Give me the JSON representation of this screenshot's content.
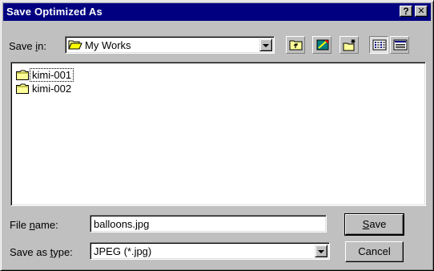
{
  "window": {
    "title": "Save Optimized As",
    "help_button": "?",
    "close_button": "✕",
    "title_bg": "#000080"
  },
  "toolbar": {
    "save_in_prefix": "Save ",
    "save_in_mnemonic": "i",
    "save_in_suffix": "n:",
    "location_value": "My Works",
    "location_icon": "open-folder-icon",
    "icons": [
      "up-one-level-icon",
      "desktop-icon",
      "create-new-folder-icon",
      "list-view-icon",
      "details-view-icon"
    ]
  },
  "files": [
    {
      "name": "kimi-001",
      "icon": "folder-icon"
    },
    {
      "name": "kimi-002",
      "icon": "folder-icon"
    }
  ],
  "file_name": {
    "label_prefix": "File ",
    "label_mnemonic": "n",
    "label_suffix": "ame:",
    "value": "balloons.jpg"
  },
  "save_type": {
    "label_prefix": "Save as ",
    "label_mnemonic": "t",
    "label_suffix": "ype:",
    "value": "JPEG (*.jpg)"
  },
  "buttons": {
    "save_mnemonic": "S",
    "save_rest": "ave",
    "cancel": "Cancel"
  }
}
